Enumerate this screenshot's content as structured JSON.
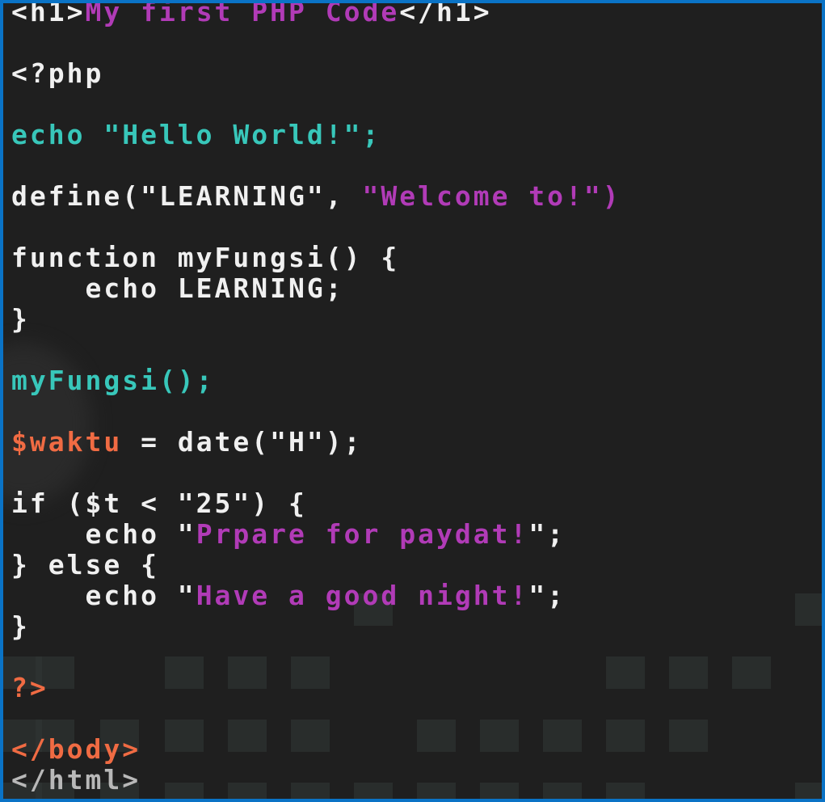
{
  "code_lines": [
    {
      "parts": [
        {
          "text": "<h1>",
          "color": "white"
        },
        {
          "text": "My first PHP Code",
          "color": "pink"
        },
        {
          "text": "</h1>",
          "color": "white"
        }
      ]
    },
    {
      "parts": []
    },
    {
      "parts": [
        {
          "text": "<?php",
          "color": "white"
        }
      ]
    },
    {
      "parts": []
    },
    {
      "parts": [
        {
          "text": "echo \"Hello World!\";",
          "color": "teal"
        }
      ]
    },
    {
      "parts": []
    },
    {
      "parts": [
        {
          "text": "define(\"LEARNING\", ",
          "color": "white"
        },
        {
          "text": "\"Welcome to!\")",
          "color": "pink"
        }
      ]
    },
    {
      "parts": []
    },
    {
      "parts": [
        {
          "text": "function myFungsi() {",
          "color": "white"
        }
      ]
    },
    {
      "parts": [
        {
          "text": "    echo LEARNING;",
          "color": "white"
        }
      ]
    },
    {
      "parts": [
        {
          "text": "}",
          "color": "white"
        }
      ]
    },
    {
      "parts": []
    },
    {
      "parts": [
        {
          "text": "myFungsi();",
          "color": "teal"
        }
      ]
    },
    {
      "parts": []
    },
    {
      "parts": [
        {
          "text": "$waktu",
          "color": "orange"
        },
        {
          "text": " = date(\"H\");",
          "color": "white"
        }
      ]
    },
    {
      "parts": []
    },
    {
      "parts": [
        {
          "text": "if ($t < \"25\") {",
          "color": "white"
        }
      ]
    },
    {
      "parts": [
        {
          "text": "    echo \"",
          "color": "white"
        },
        {
          "text": "Prpare for paydat!",
          "color": "pink"
        },
        {
          "text": "\";",
          "color": "white"
        }
      ]
    },
    {
      "parts": [
        {
          "text": "} else {",
          "color": "white"
        }
      ]
    },
    {
      "parts": [
        {
          "text": "    echo \"",
          "color": "white"
        },
        {
          "text": "Have a good night!",
          "color": "pink"
        },
        {
          "text": "\";",
          "color": "white"
        }
      ]
    },
    {
      "parts": [
        {
          "text": "}",
          "color": "white"
        }
      ]
    },
    {
      "parts": []
    },
    {
      "parts": [
        {
          "text": "?>",
          "color": "orange"
        }
      ]
    },
    {
      "parts": []
    },
    {
      "parts": [
        {
          "text": "</body>",
          "color": "orange"
        }
      ]
    },
    {
      "parts": [
        {
          "text": "</html>",
          "color": "gray"
        }
      ]
    }
  ]
}
